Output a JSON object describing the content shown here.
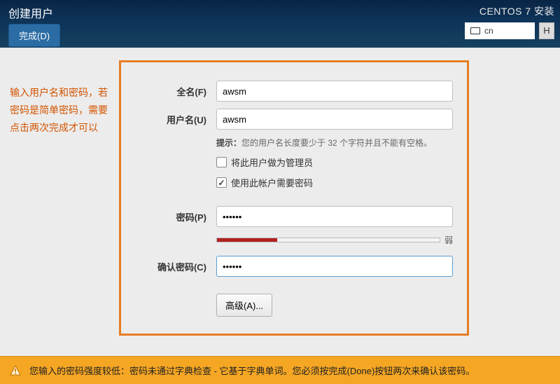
{
  "header": {
    "page_title": "创建用户",
    "done_button": "完成(D)",
    "installer_title": "CENTOS 7 安装",
    "keyboard_layout": "cn",
    "help_label": "H"
  },
  "sidebar": {
    "note": "输入用户名和密码，若密码是简单密码，需要点击两次完成才可以"
  },
  "form": {
    "fullname_label": "全名(F)",
    "fullname_value": "awsm",
    "username_label": "用户名(U)",
    "username_value": "awsm",
    "hint_label": "提示：",
    "hint_text": "您的用户名长度要少于 32 个字符并且不能有空格。",
    "admin_checkbox": {
      "checked": false,
      "label": "将此用户做为管理员"
    },
    "require_password_checkbox": {
      "checked": true,
      "label": "使用此帐户需要密码"
    },
    "password_label": "密码(P)",
    "password_value": "••••••",
    "strength_text": "弱",
    "confirm_label": "确认密码(C)",
    "confirm_value": "••••••",
    "advanced_button": "高级(A)..."
  },
  "warning": {
    "text": "您输入的密码强度较低：密码未通过字典检查 - 它基于字典单词。您必须按完成(Done)按钮两次来确认该密码。"
  }
}
